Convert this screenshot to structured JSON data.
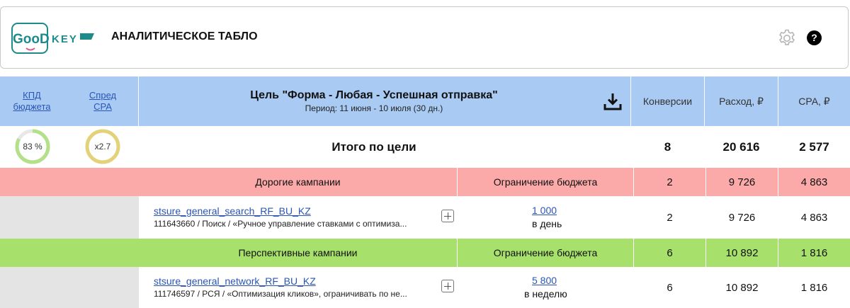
{
  "header": {
    "logo_text_left": "GooD",
    "logo_text_right": "KEY",
    "title": "АНАЛИТИЧЕСКОЕ ТАБЛО",
    "help_label": "?"
  },
  "table_header": {
    "kpi_budget_label": "КПД бюджета",
    "spread_cpa_label": "Спред CPA",
    "goal_title": "Цель \"Форма - Любая - Успешная отправка\"",
    "goal_period": "Период: 11 июня - 10 июля (30 дн.)",
    "col_conversions": "Конверсии",
    "col_spend": "Расход, ₽",
    "col_cpa": "CPA, ₽"
  },
  "totals": {
    "kpi_budget": "83 %",
    "kpi_budget_fraction": 0.83,
    "spread_cpa": "x2.7",
    "label": "Итого по цели",
    "conversions": "8",
    "spend": "20 616",
    "cpa": "2 577"
  },
  "groups": [
    {
      "label": "Дорогие кампании",
      "limit_label": "Ограничение бюджета",
      "conversions": "2",
      "spend": "9 726",
      "cpa": "4 863",
      "color": "#fca9a9",
      "campaign": {
        "name": "stsure_general_search_RF_BU_KZ",
        "desc": "111643660 / Поиск / «Ручное управление ставками с оптимиза...",
        "budget": "1 000",
        "budget_period": "в день",
        "conversions": "2",
        "spend": "9 726",
        "cpa": "4 863"
      }
    },
    {
      "label": "Перспективные кампании",
      "limit_label": "Ограничение бюджета",
      "conversions": "6",
      "spend": "10 892",
      "cpa": "1 816",
      "color": "#a8e06c",
      "campaign": {
        "name": "stsure_general_network_RF_BU_KZ",
        "desc": "111746597 / РСЯ / «Оптимизация кликов», ограничивать по не...",
        "budget": "5 800",
        "budget_period": "в неделю",
        "conversions": "6",
        "spend": "10 892",
        "cpa": "1 816"
      }
    }
  ],
  "icons": {
    "logo": "goodkey-logo",
    "gear": "gear-icon",
    "help": "help-icon",
    "download": "download-icon",
    "plus": "plus-icon"
  },
  "colors": {
    "header_blue": "#a9cbf3",
    "expensive_red": "#fca9a9",
    "perspective_green": "#a8e06c",
    "gauge_green": "#b5e08a",
    "gauge_yellow": "#e3d27a",
    "link_blue": "#2a55b7",
    "logo_teal": "#1f8a8a"
  }
}
